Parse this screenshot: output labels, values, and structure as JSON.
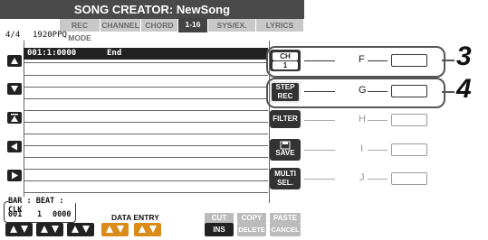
{
  "screen": {
    "title": "SONG CREATOR: NewSong",
    "tabs": [
      "REC MODE",
      "CHANNEL",
      "CHORD",
      "1-16",
      "SYS/EX.",
      "LYRICS"
    ],
    "active_tab": "1-16",
    "time_signature": "4/4",
    "resolution": "1920PPQ"
  },
  "events": [
    {
      "position": "001:1:0000",
      "event": "End"
    }
  ],
  "side_buttons": [
    {
      "label1": "CH",
      "label2": "1",
      "letter": "F"
    },
    {
      "label1": "STEP",
      "label2": "REC",
      "letter": "G"
    },
    {
      "label1": "FILTER",
      "label2": "",
      "letter": "H"
    },
    {
      "label1": "",
      "label2": "SAVE",
      "letter": "I"
    },
    {
      "label1": "MULTI",
      "label2": "SEL.",
      "letter": "J"
    }
  ],
  "callouts": [
    "3",
    "4"
  ],
  "footer": {
    "bar_header": "BAR : BEAT : CLK",
    "bar": "001",
    "beat": "1",
    "clk": "0000",
    "data_entry": "DATA ENTRY",
    "cut": "CUT",
    "copy": "COPY",
    "paste": "PASTE",
    "ins": "INS",
    "delete": "DELETE",
    "cancel": "CANCEL"
  }
}
